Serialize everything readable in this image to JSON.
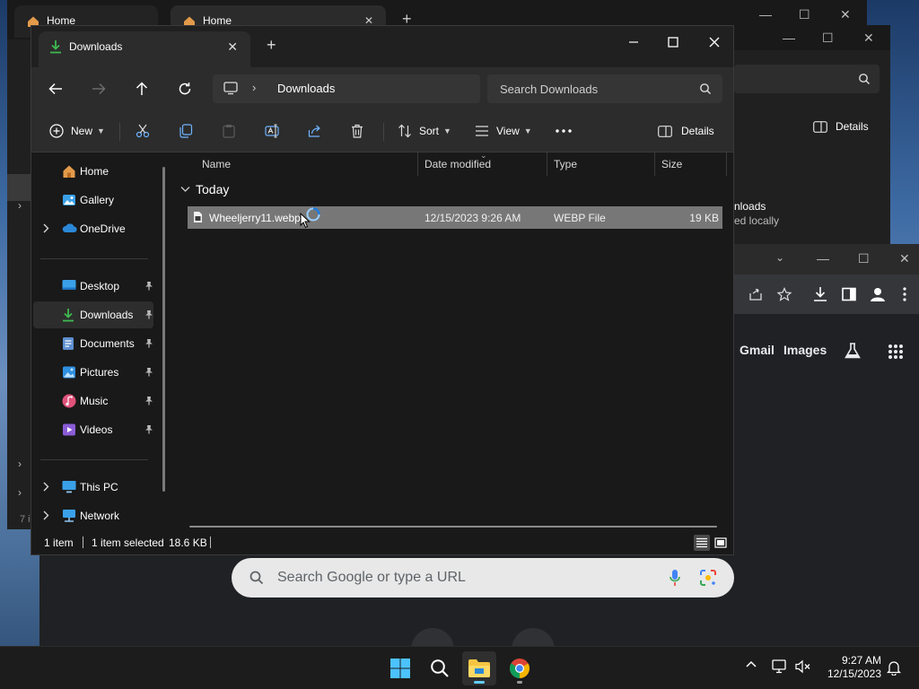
{
  "background": {
    "explorer_back": {
      "tabs": [
        "Home",
        "Home"
      ],
      "details_label": "Details",
      "side_text_1": "nloads",
      "side_text_2": "ed locally",
      "footer_num": "7 i"
    },
    "chrome": {
      "links": [
        "Gmail",
        "Images"
      ],
      "search_placeholder": "Search Google or type a URL"
    }
  },
  "explorer": {
    "tab_title": "Downloads",
    "breadcrumb": "Downloads",
    "search_placeholder": "Search Downloads",
    "commands": {
      "new": "New",
      "sort": "Sort",
      "view": "View",
      "details": "Details"
    },
    "sidebar": {
      "top": [
        {
          "label": "Home"
        },
        {
          "label": "Gallery"
        },
        {
          "label": "OneDrive"
        }
      ],
      "quick": [
        {
          "label": "Desktop"
        },
        {
          "label": "Downloads"
        },
        {
          "label": "Documents"
        },
        {
          "label": "Pictures"
        },
        {
          "label": "Music"
        },
        {
          "label": "Videos"
        }
      ],
      "bottom": [
        {
          "label": "This PC"
        },
        {
          "label": "Network"
        }
      ]
    },
    "columns": [
      "Name",
      "Date modified",
      "Type",
      "Size"
    ],
    "group_label": "Today",
    "files": [
      {
        "name": "Wheeljerry11.webp",
        "date": "12/15/2023 9:26 AM",
        "type": "WEBP File",
        "size": "19 KB"
      }
    ],
    "status": {
      "count": "1 item",
      "selected": "1 item selected",
      "size": "18.6 KB"
    }
  },
  "taskbar": {
    "time": "9:27 AM",
    "date": "12/15/2023"
  },
  "colors": {
    "accent": "#60cdff",
    "selection": "#777777",
    "download_green": "#3fb950"
  }
}
